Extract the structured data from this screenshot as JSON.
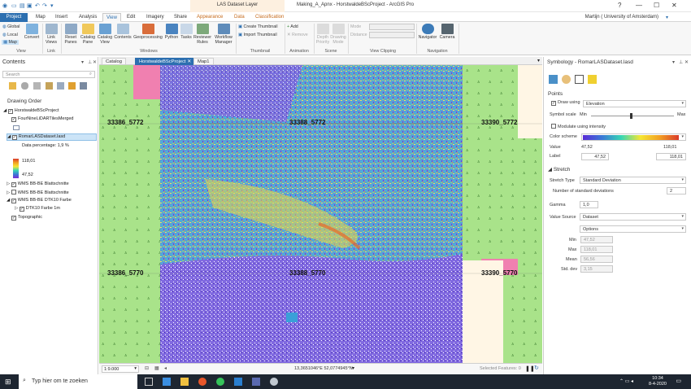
{
  "titlebar": {
    "context_group": "LAS Dataset Layer",
    "window_title": "Making_A_Apnx - HorstwaldeBScProject - ArcGIS Pro",
    "help": "?",
    "minimize": "—",
    "maximize": "☐",
    "close": "✕"
  },
  "tabs": {
    "project": "Project",
    "map": "Map",
    "insert": "Insert",
    "analysis": "Analysis",
    "view": "View",
    "edit": "Edit",
    "imagery": "Imagery",
    "share": "Share",
    "appearance": "Appearance",
    "data": "Data",
    "classification": "Classification"
  },
  "user": "Martijn ( University of Amsterdam)",
  "ribbon": {
    "view_group": {
      "global": "Global",
      "local": "Local",
      "map": "Map",
      "convert": "Convert",
      "label": "View"
    },
    "link_group": {
      "link_views": "Link Views",
      "label": "Link"
    },
    "windows_group": {
      "reset_panes": "Reset Panes",
      "catalog_pane": "Catalog Pane",
      "catalog_view": "Catalog View",
      "contents": "Contents",
      "geoprocessing": "Geoprocessing",
      "python": "Python",
      "tasks": "Tasks",
      "reviewer_rules": "Reviewer Rules",
      "workflow_manager": "Workflow Manager",
      "label": "Windows"
    },
    "thumbnail_group": {
      "create": "Create Thumbnail",
      "import": "Import Thumbnail",
      "label": "Thumbnail"
    },
    "animation_group": {
      "add": "Add",
      "remove": "Remove",
      "label": "Animation"
    },
    "scene_group": {
      "depth_priority": "Depth Priority",
      "drawing_mode": "Drawing Mode",
      "label": "Scene"
    },
    "clipping_group": {
      "mode": "Mode",
      "distance": "Distance",
      "label": "View Clipping"
    },
    "navigation_group": {
      "navigator": "Navigator",
      "camera": "Camera",
      "label": "Navigation"
    }
  },
  "contents": {
    "title": "Contents",
    "search_placeholder": "Search",
    "drawing_order": "Drawing Order",
    "tree": {
      "project": "HorstwaldeBScProject",
      "fourninelidar": "FourNineLiDARTilesMerged",
      "lasdataset": "RomarLASDataset.lasd",
      "data_percentage": "Data percentage: 1,9 %",
      "legend_max": "118,01",
      "legend_min": "47,52",
      "wms1": "WMS BB-BE Blattschnitte",
      "wms2": "WMS BB-BE Blattschnitte",
      "wms3": "WMS BB-BE DTK10 Farbe",
      "dtk10": "DTK10 Farbe 1m",
      "topographic": "Topographic"
    }
  },
  "doctabs": {
    "catalog": "Catalog",
    "project": "HorstwaldeBScProject",
    "map1": "Map1"
  },
  "map": {
    "labels": [
      "33386_5772",
      "33388_5772",
      "33390_5772",
      "33386_5770",
      "33388_5770",
      "33390_5770"
    ]
  },
  "status": {
    "scale": "1:9.000",
    "coords": "13,3651046°E 52,0774945°N",
    "selected": "Selected Features: 0"
  },
  "symbology": {
    "title": "Symbology - RomarLASDataset.lasd",
    "points_heading": "Points",
    "draw_using_label": "Draw using",
    "draw_using_value": "Elevation",
    "symbol_scale_label": "Symbol scale",
    "min_label": "Min",
    "max_label": "Max",
    "modulate": "Modulate using intensity",
    "color_scheme_label": "Color scheme",
    "value_label": "Value",
    "value_min": "47,52",
    "value_max": "118,01",
    "label_label": "Label",
    "label_min": "47,52",
    "label_max": "118,01",
    "stretch_heading": "Stretch",
    "stretch_type_label": "Stretch Type",
    "stretch_type_value": "Standard Deviation",
    "num_std_label": "Number of standard deviations",
    "num_std_value": "2",
    "gamma_label": "Gamma",
    "gamma_value": "1,0",
    "value_source_label": "Value Source",
    "value_source_value": "Dataset",
    "options": "Options",
    "stats_min_label": "Min",
    "stats_min": "47,52",
    "stats_max_label": "Max",
    "stats_max": "118,01",
    "stats_mean_label": "Mean",
    "stats_mean": "56,56",
    "stats_std_label": "Std. dev",
    "stats_std": "3,15"
  },
  "taskbar": {
    "search": "Typ hier om te zoeken",
    "time": "10:34",
    "date": "8-4-2020"
  },
  "colors": {
    "accent": "#2c6fb0",
    "context": "#c66a1a"
  }
}
